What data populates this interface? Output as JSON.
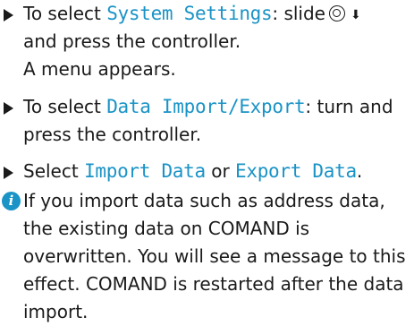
{
  "steps": [
    {
      "prefix": "To select ",
      "highlight": "System Settings",
      "suffix": ": slide",
      "icons": [
        "controller-icon",
        "down-arrow-icon"
      ],
      "line2": "and press the controller.",
      "line3": "A menu appears."
    },
    {
      "prefix": "To select ",
      "highlight": "Data Import/Export",
      "suffix": ": turn and",
      "line2": "press the controller."
    },
    {
      "prefix": "Select ",
      "highlight": "Import Data",
      "middle": " or ",
      "highlight2": "Export Data",
      "suffix": "."
    }
  ],
  "note": {
    "icon": "info-icon",
    "icon_glyph": "i",
    "lines": [
      "If you import data such as address data,",
      "the existing data on COMAND is",
      "overwritten. You will see a message to this",
      "effect. COMAND is restarted after the data",
      "import."
    ]
  },
  "colors": {
    "highlight": "#1a93c6",
    "text": "#1a1a1a"
  }
}
